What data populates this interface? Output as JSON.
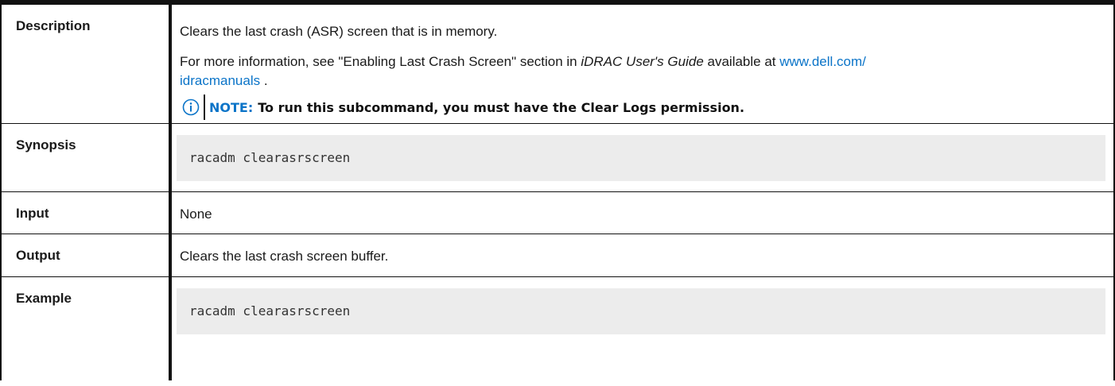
{
  "rows": {
    "description": {
      "label": "Description",
      "para1": "Clears the last crash (ASR) screen that is in memory.",
      "para2_pre": "For more information, see \"Enabling Last Crash Screen\" section in ",
      "para2_italic": "iDRAC User's Guide",
      "para2_mid": " available at ",
      "link_line1": "www.dell.com/",
      "link_line2": "idracmanuals",
      "para2_post": " .",
      "note_prefix": "NOTE:",
      "note_text": "To run this subcommand, you must have the Clear Logs permission.",
      "note_icon": "info-circle-icon"
    },
    "synopsis": {
      "label": "Synopsis",
      "code": "racadm clearasrscreen"
    },
    "input": {
      "label": "Input",
      "value": "None"
    },
    "output": {
      "label": "Output",
      "value": "Clears the last crash screen buffer."
    },
    "example": {
      "label": "Example",
      "code": "racadm clearasrscreen"
    }
  },
  "colors": {
    "link": "#0b74c8",
    "code_bg": "#ececec",
    "border": "#111111"
  }
}
